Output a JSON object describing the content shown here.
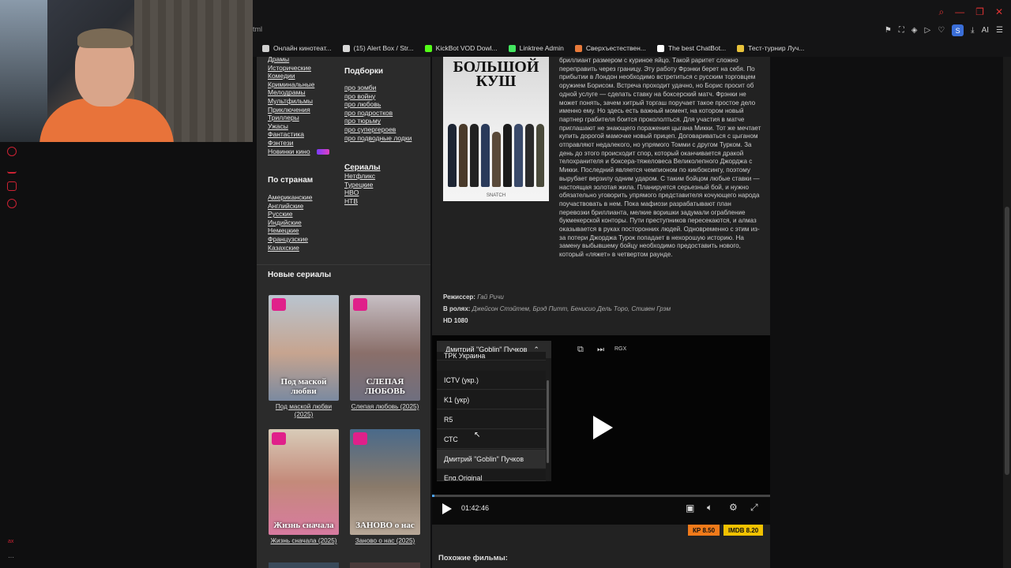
{
  "browser": {
    "url_fragment": "tml",
    "bookmarks": [
      {
        "label": "Онлайн кинотеат...",
        "color": "#cfcfcf"
      },
      {
        "label": "(15) Alert Box / Str...",
        "color": "#d8d8d8"
      },
      {
        "label": "KickBot VOD Dowl...",
        "color": "#53fc18"
      },
      {
        "label": "Linktree Admin",
        "color": "#43e660"
      },
      {
        "label": "Сверхъестествен...",
        "color": "#e87a3a"
      },
      {
        "label": "The best ChatBot...",
        "color": "#ffffff"
      },
      {
        "label": "Тест-турнир Луч...",
        "color": "#e8c23a"
      }
    ],
    "profile_letter": "S",
    "ai_label": "AI"
  },
  "sidebar_left": {
    "genres": [
      "Драмы",
      "Исторические",
      "Комедии",
      "Криминальные",
      "Мелодрамы",
      "Мультфильмы",
      "Приключения",
      "Триллеры",
      "Ужасы",
      "Фантастика",
      "Фэнтези",
      "Новинки кино"
    ],
    "collections_title": "Подборки",
    "collections": [
      "про зомби",
      "про войну",
      "про любовь",
      "про подростков",
      "про тюрьму",
      "про супергероев",
      "про подводные лодки"
    ],
    "countries_title": "По странам",
    "countries": [
      "Американские",
      "Английские",
      "Русские",
      "Индийские",
      "Немецкие",
      "Французские",
      "Казахские"
    ],
    "series_title": "Сериалы",
    "series": [
      "Нетфликс",
      "Турецкие",
      "HBO",
      "НТВ"
    ],
    "new_series_title": "Новые сериалы",
    "new_series": [
      {
        "title": "Под маской любви (2025)",
        "poster_title": "Под маской любви"
      },
      {
        "title": "Слепая любовь (2025)",
        "poster_title": "СЛЕПАЯ ЛЮБОВЬ"
      },
      {
        "title": "Жизнь сначала (2025)",
        "poster_title": "Жизнь сначала"
      },
      {
        "title": "Заново о нас (2025)",
        "poster_title": "ЗАНОВО о нас"
      }
    ]
  },
  "movie": {
    "poster_title": "БОЛЬШОЙ КУШ",
    "poster_sub": "SNATCH",
    "description": "бриллиант размером с куриное яйцо. Такой раритет сложно переправить через границу. Эту работу Фрэнки берет на себя. По прибытии в Лондон необходимо встретиться с русским торговцем оружием Борисом. Встреча проходит удачно, но Борис просит об одной услуге — сделать ставку на боксерский матч. Фрэнки не может понять, зачем хитрый торгаш поручает такое простое дело именно ему. Но здесь есть важный момент, на котором новый партнер грабителя боится прокололться. Для участия в матче приглашают не знающего поражения цыгана Микки. Тот же мечтает купить дорогой мамочке новый прицеп. Договариваться с цыганом отправляют недалекого, но упрямого Томми с другом Турком. За день до этого происходит спор, который оканчивается дракой телохранителя и боксера-тяжеловеса Великолепного Джорджа с Микки. Последний является чемпионом по кикбоксингу, поэтому вырубает верзилу одним ударом. С таким бойцом любые ставки — настоящая золотая жила. Планируется серьезный бой, и нужно обязательно уговорить упрямого представителя кочующего народа поучаствовать в нем. Пока мафиози разрабатывают план перевозки бриллианта, мелкие воришки задумали ограбление букмекерской конторы. Пути преступников пересекаются, и алмаз оказывается в руках посторонних людей. Одновременно с этим из-за потери Джорджа Турок попадает в нехорошую историю. На замену выбывшему бойцу необходимо предоставить нового, который «ляжет» в четвертом раунде.",
    "director_label": "Режиссер:",
    "director": "Гай Ричи",
    "cast_label": "В ролях:",
    "cast": "Джейсон Стэйтем, Брэд Питт, Бенисио Дель Торо, Стивен Грэм",
    "quality": "HD 1080"
  },
  "player": {
    "voice_selected": "Дмитрий \"Goblin\" Пучков",
    "voices": [
      "ТРК Украина",
      "ICTV (укр.)",
      "K1 (укр)",
      "R5",
      "СТС",
      "Дмитрий \"Goblin\" Пучков",
      "Eng.Original"
    ],
    "time": "01:42:46",
    "progress": 0.004,
    "top_label": "RGX",
    "kp": "КР 8.50",
    "imdb": "IMDB 8.20",
    "kp_color": "#f07a1a",
    "imdb_color": "#f2c200"
  },
  "similar_title": "Похожие фильмы:"
}
